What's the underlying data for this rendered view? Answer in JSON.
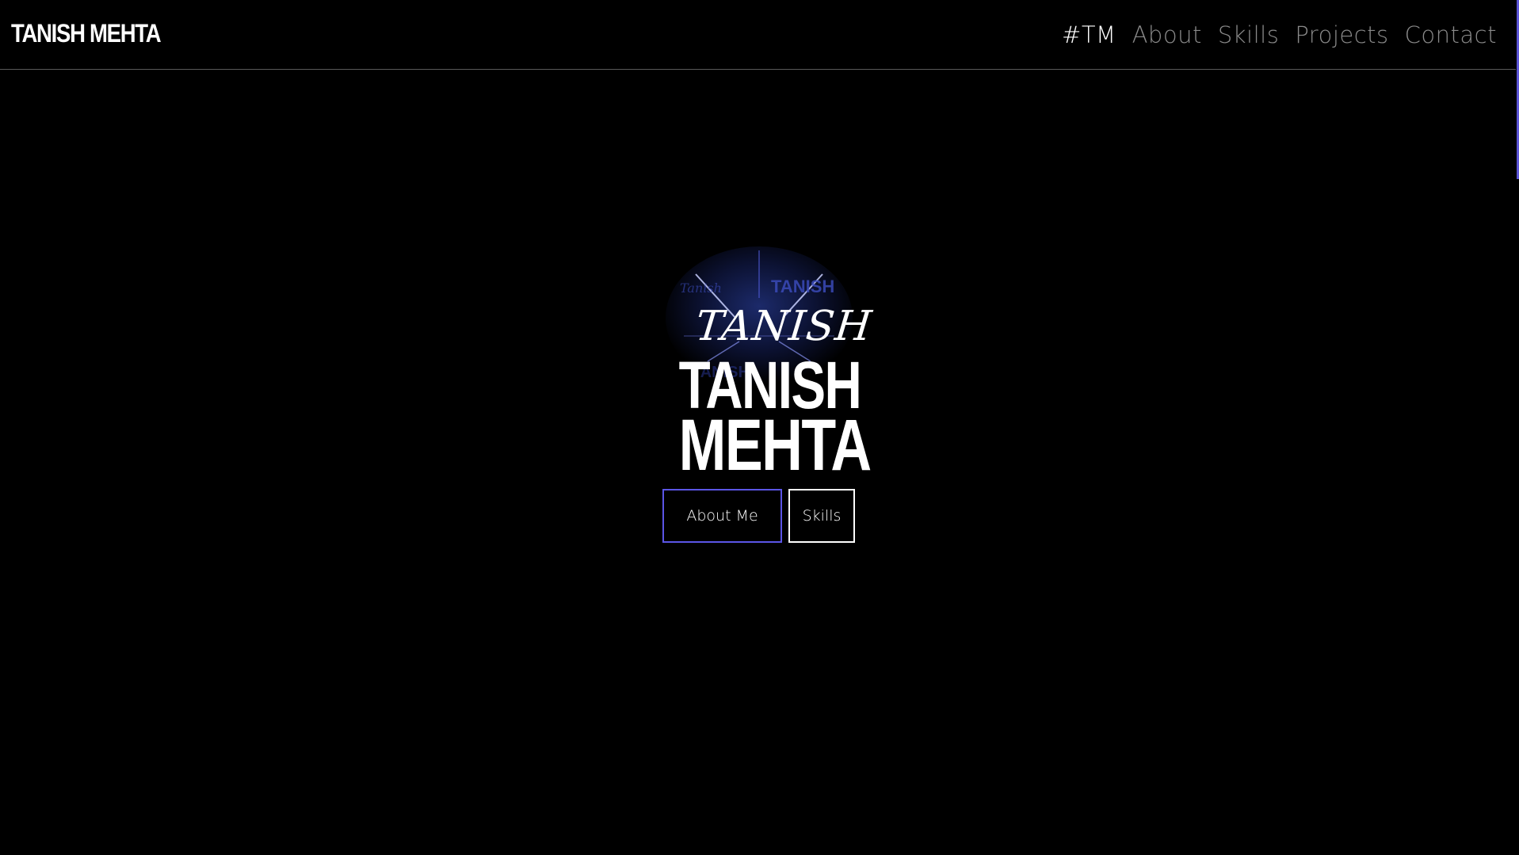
{
  "header": {
    "brand": "TANISH MEHTA",
    "nav": [
      {
        "label": "#TM",
        "active": true
      },
      {
        "label": "About",
        "active": false
      },
      {
        "label": "Skills",
        "active": false
      },
      {
        "label": "Projects",
        "active": false
      },
      {
        "label": "Contact",
        "active": false
      }
    ]
  },
  "hero": {
    "emblem_icon": "tanish-logo-emblem",
    "script_name": "TANISH",
    "name_line1": "TANISH",
    "name_line2": "MEHTA",
    "buttons": {
      "about": "About Me",
      "skills": "Skills"
    }
  },
  "colors": {
    "background": "#000000",
    "accent": "#5b55e6",
    "nav_inactive": "#8a8a8a",
    "text": "#ffffff"
  }
}
